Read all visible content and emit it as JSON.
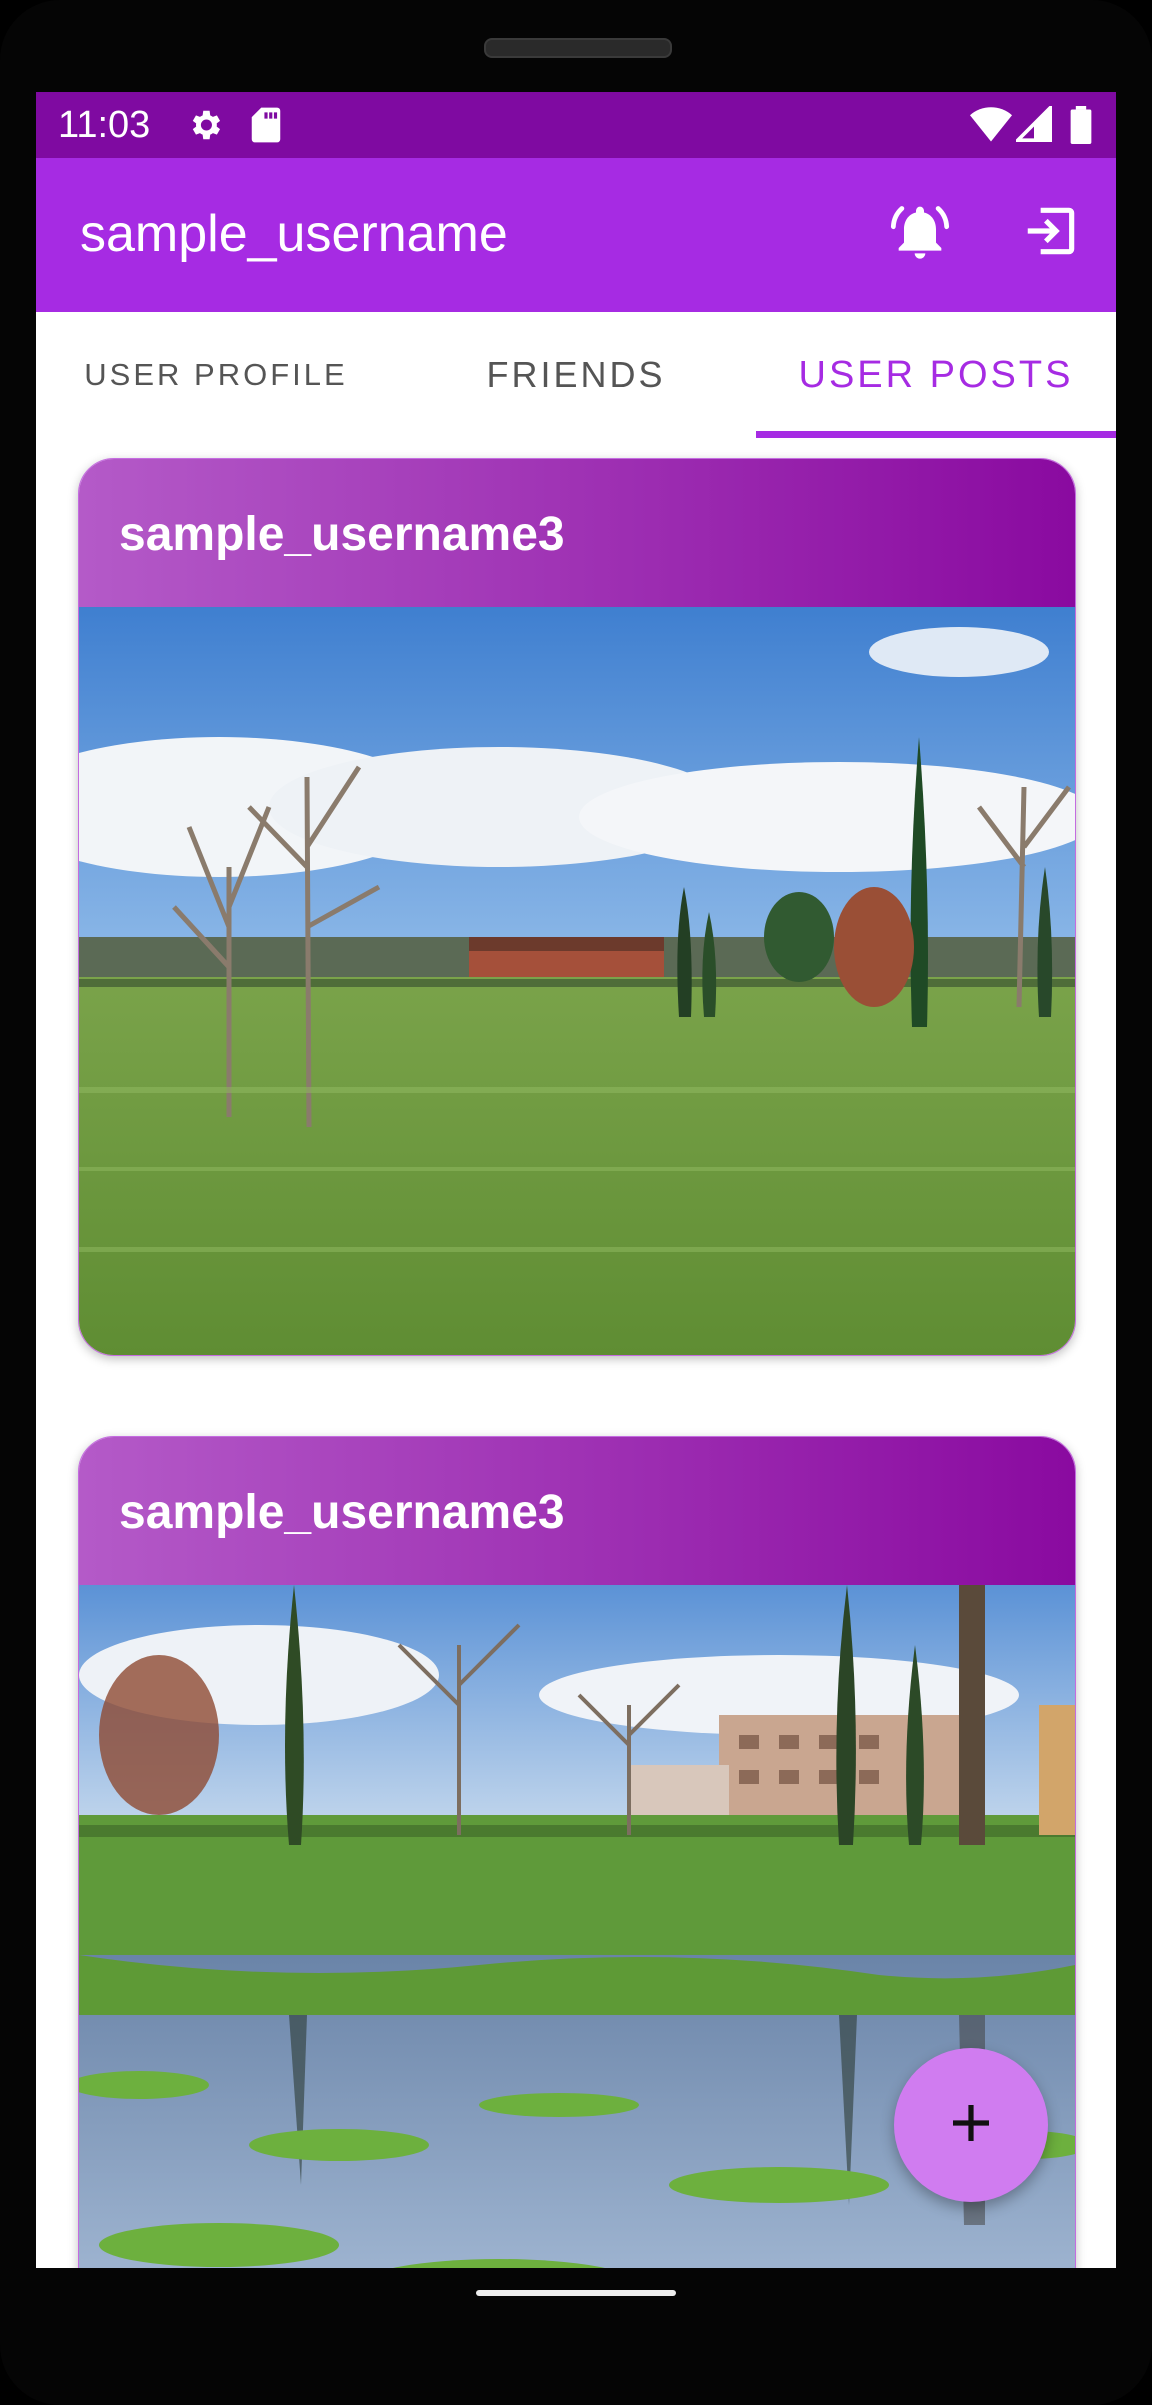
{
  "status_bar": {
    "time": "11:03",
    "icons": [
      "gear-icon",
      "sd-card-icon",
      "wifi-icon",
      "cell-signal-icon",
      "battery-icon"
    ]
  },
  "app_bar": {
    "title": "sample_username",
    "actions": [
      "notification-bell-icon",
      "logout-icon"
    ]
  },
  "tabs": [
    {
      "label": "USER PROFILE",
      "selected": false
    },
    {
      "label": "FRIENDS",
      "selected": false
    },
    {
      "label": "USER POSTS",
      "selected": true
    }
  ],
  "posts": [
    {
      "username": "sample_username3",
      "image": "park landscape with bare trees, cypresses and brick building"
    },
    {
      "username": "sample_username3",
      "image": "park lawn with puddle reflecting trees and buildings"
    }
  ],
  "fab": {
    "icon": "plus-icon"
  },
  "colors": {
    "status_bar": "#7f0aa1",
    "app_bar": "#a62be3",
    "accent": "#a62be3",
    "card_header_start": "#b45ac8",
    "card_header_end": "#8a0aa0",
    "fab": "#d07cf0"
  }
}
